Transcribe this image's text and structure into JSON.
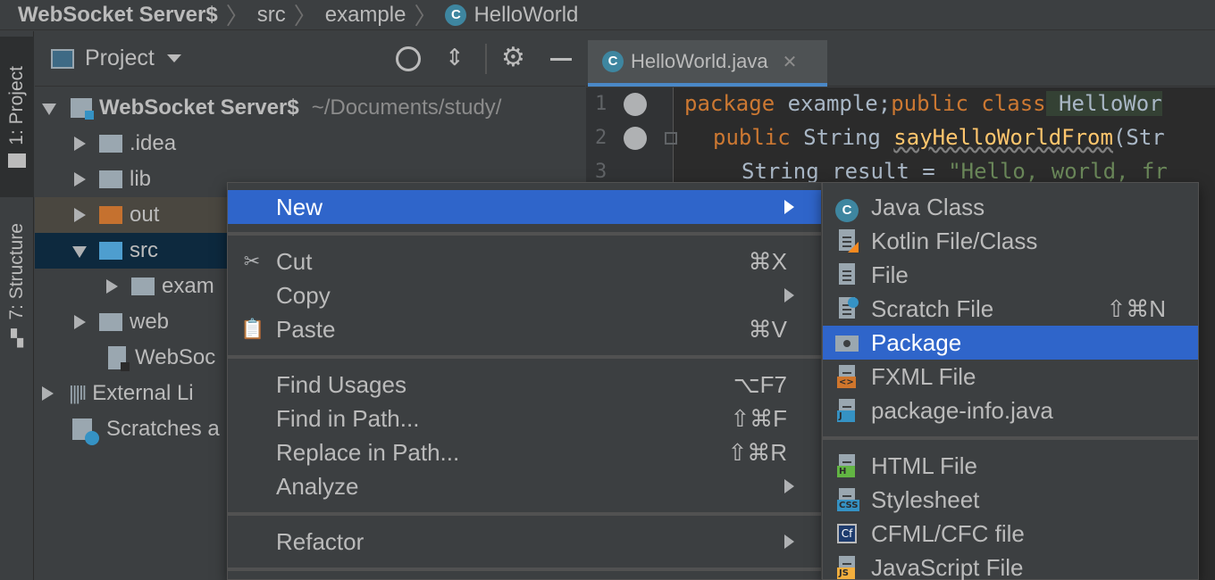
{
  "breadcrumb": {
    "items": [
      "WebSocket Server$",
      "src",
      "example",
      "HelloWorld"
    ],
    "class_icon_letter": "C"
  },
  "tool_strip": {
    "project_tab": "1: Project",
    "structure_tab": "7: Structure"
  },
  "project_panel": {
    "title": "Project",
    "tree": [
      {
        "label": "WebSocket Server$",
        "path": "~/Documents/study/",
        "expanded": true
      },
      {
        "label": ".idea"
      },
      {
        "label": "lib"
      },
      {
        "label": "out"
      },
      {
        "label": "src",
        "expanded": true,
        "selected": true
      },
      {
        "label": "exam"
      },
      {
        "label": "web"
      },
      {
        "label": "WebSoc"
      },
      {
        "label": "External Li"
      },
      {
        "label": "Scratches a"
      }
    ]
  },
  "editor": {
    "tab_label": "HelloWorld.java",
    "line_numbers": [
      "1",
      "2",
      "3"
    ],
    "lines": [
      {
        "kw1": "package",
        "plain1": " example;",
        "kw2": "public class",
        "cls": " HelloWor"
      },
      {
        "kw1": "public",
        "plain1": " String ",
        "mth": "sayHelloWorldFrom",
        "plain2": "(Str"
      },
      {
        "plain1": "String result = ",
        "str": "\"Hello, world, fr"
      }
    ]
  },
  "context_menu": {
    "new_label": "New",
    "cut_label": "Cut",
    "cut_shortcut": "⌘X",
    "copy_label": "Copy",
    "paste_label": "Paste",
    "paste_shortcut": "⌘V",
    "find_usages_label": "Find Usages",
    "find_usages_shortcut": "⌥F7",
    "find_in_path_label": "Find in Path...",
    "find_in_path_shortcut": "⇧⌘F",
    "replace_in_path_label": "Replace in Path...",
    "replace_in_path_shortcut": "⇧⌘R",
    "analyze_label": "Analyze",
    "refactor_label": "Refactor"
  },
  "new_submenu": {
    "java_class": "Java Class",
    "kotlin_file": "Kotlin File/Class",
    "file": "File",
    "scratch_file": "Scratch File",
    "scratch_file_shortcut": "⇧⌘N",
    "package": "Package",
    "fxml_file": "FXML File",
    "package_info": "package-info.java",
    "html_file": "HTML File",
    "stylesheet": "Stylesheet",
    "cfml_file": "CFML/CFC file",
    "javascript_file": "JavaScript File",
    "tags": {
      "fxml": "<>",
      "package_info": "J",
      "html": "H",
      "css": "CSS",
      "cfml": "Cf",
      "js": "JS"
    }
  },
  "colors": {
    "menu_highlight": "#2f65ca",
    "tree_selection": "#0d293e",
    "keyword": "#cc7832",
    "string": "#6a8759",
    "method": "#ffc66d"
  }
}
